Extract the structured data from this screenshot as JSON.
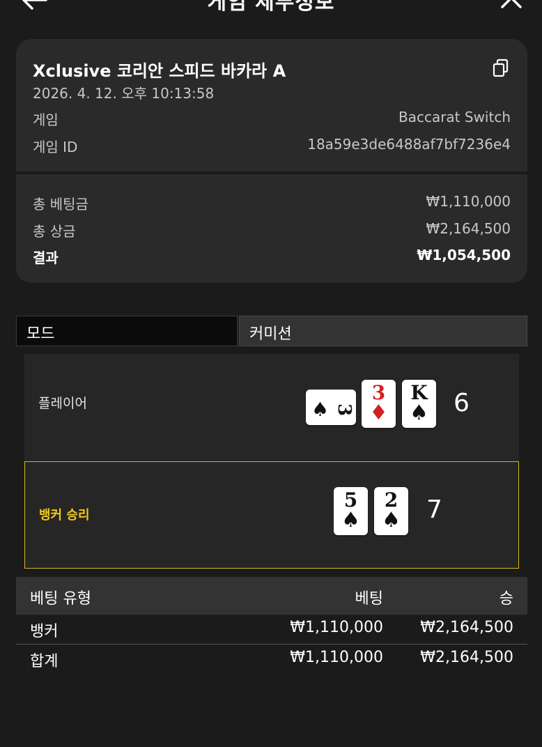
{
  "header": {
    "title": "게임 세부정보"
  },
  "summary": {
    "game_title": "Xclusive 코리안 스피드 바카라 A",
    "datetime": "2026. 4. 12. 오후 10:13:58",
    "game_label": "게임",
    "game_value": "Baccarat Switch",
    "game_id_label": "게임 ID",
    "game_id_value": "18a59e3de6488af7bf7236e4",
    "total_bet_label": "총 베팅금",
    "total_bet_value": "₩1,110,000",
    "total_prize_label": "총 상금",
    "total_prize_value": "₩2,164,500",
    "result_label": "결과",
    "result_value": "₩1,054,500"
  },
  "mode": {
    "mode_label": "모드",
    "mode_value": "커미션"
  },
  "hands": {
    "player": {
      "label": "플레이어",
      "score": "6",
      "cards": [
        {
          "rank": "3",
          "suit": "♠",
          "color": "#111111",
          "rotated": true
        },
        {
          "rank": "3",
          "suit": "♦",
          "color": "#d42020",
          "rotated": false
        },
        {
          "rank": "K",
          "suit": "♠",
          "color": "#111111",
          "rotated": false
        }
      ]
    },
    "banker": {
      "label": "뱅커 승리",
      "score": "7",
      "cards": [
        {
          "rank": "5",
          "suit": "♠",
          "color": "#111111",
          "rotated": false
        },
        {
          "rank": "2",
          "suit": "♠",
          "color": "#111111",
          "rotated": false
        }
      ]
    }
  },
  "bets": {
    "columns": [
      "베팅 유형",
      "베팅",
      "승"
    ],
    "rows": [
      [
        "뱅커",
        "₩1,110,000",
        "₩2,164,500"
      ],
      [
        "합계",
        "₩1,110,000",
        "₩2,164,500"
      ]
    ]
  },
  "colors": {
    "highlight": "#d9b81e",
    "background": "#1b1b1b",
    "card_bg": "#2a2a2a"
  },
  "icons": {
    "back": "arrow-left-icon",
    "close": "close-icon",
    "copy": "copy-icon"
  }
}
